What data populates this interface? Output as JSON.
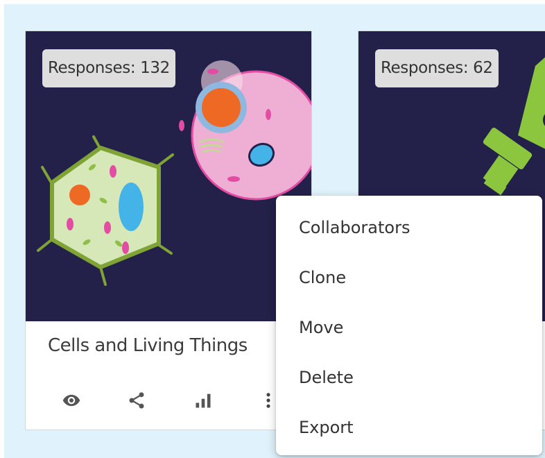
{
  "cards": [
    {
      "badge": "Responses: 132",
      "title": "Cells and Living Things",
      "image_icon": "cells-illustration",
      "actions": [
        "eye-icon",
        "share-icon",
        "bar-chart-icon",
        "more-vert-icon"
      ]
    },
    {
      "badge": "Responses: 62",
      "title": "",
      "image_icon": "microscope-illustration",
      "actions": [
        "more-vert-icon"
      ]
    }
  ],
  "context_menu": {
    "items": [
      "Collaborators",
      "Clone",
      "Move",
      "Delete",
      "Export"
    ]
  },
  "colors": {
    "background": "#e0f2fb",
    "image_bg": "#23214a",
    "icon": "#555555"
  }
}
